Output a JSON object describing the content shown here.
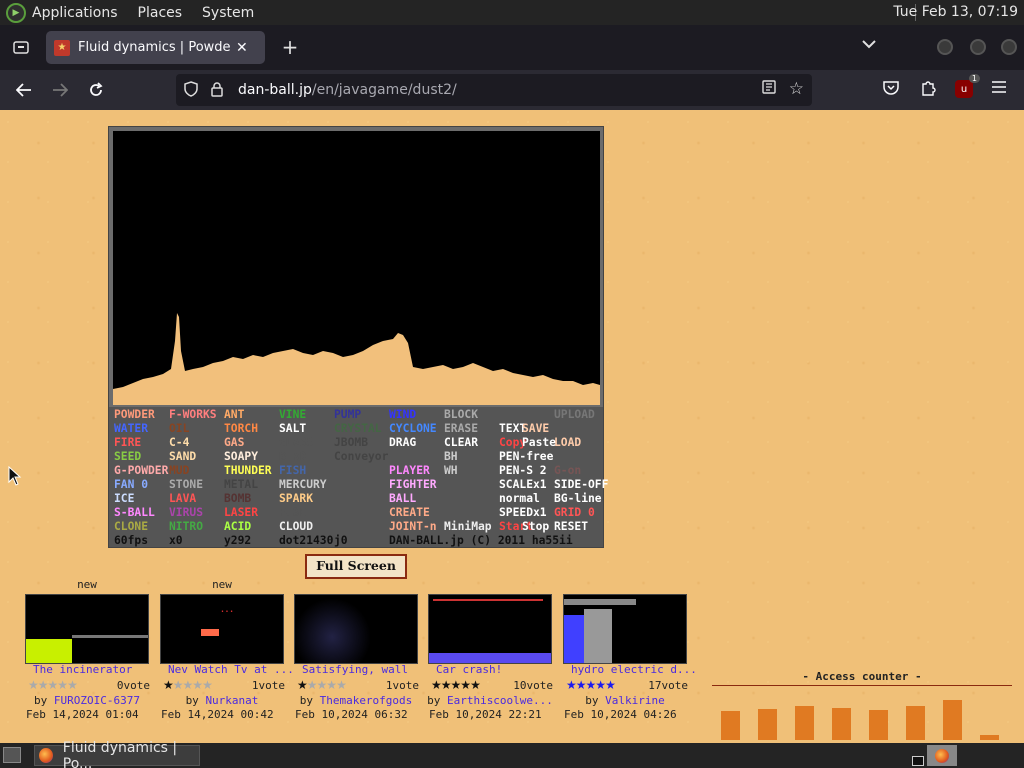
{
  "topbar": {
    "menus": [
      "Applications",
      "Places",
      "System"
    ],
    "clock": "Tue Feb 13, 07:19"
  },
  "tab": {
    "title": "Fluid dynamics | Powder Game",
    "close": "✕",
    "new": "+"
  },
  "url": {
    "domain": "dan-ball.jp",
    "path": "/en/javagame/dust2/"
  },
  "ublock_count": "1",
  "panel_rows": [
    [
      [
        "POWDER",
        "#ff9a7a"
      ],
      [
        "F-WORKS",
        "#ff7f7f"
      ],
      [
        "ANT",
        "#ffaa66"
      ],
      [
        "VINE",
        "#33aa33"
      ],
      [
        "PUMP",
        "#333399"
      ],
      [
        "WIND",
        "#3333ff"
      ],
      [
        "BLOCK",
        "#aaaaaa"
      ],
      [
        "",
        "#fff"
      ],
      [
        "",
        "#fff"
      ],
      [
        "UPLOAD",
        "#777777"
      ]
    ],
    [
      [
        "WATER",
        "#4466ff"
      ],
      [
        "OIL",
        "#884422"
      ],
      [
        "TORCH",
        "#ff8844"
      ],
      [
        "SALT",
        "#ffffff"
      ],
      [
        "CRYSTAL",
        "#446644"
      ],
      [
        "CYCLONE",
        "#4488ff"
      ],
      [
        "ERASE",
        "#aaaaaa"
      ],
      [
        "TEXT",
        "#ffffff"
      ],
      [
        "SAVE",
        "#ffccaa"
      ],
      [
        "",
        ""
      ]
    ],
    [
      [
        "FIRE",
        "#ff5555"
      ],
      [
        "C-4",
        "#ffddaa"
      ],
      [
        "GAS",
        "#ffaa88"
      ],
      [
        "GLASS",
        "#555555"
      ],
      [
        "JBOMB",
        "#444444"
      ],
      [
        "DRAG",
        "#ffffff"
      ],
      [
        "CLEAR",
        "#ffffff"
      ],
      [
        "Copy",
        "#ff4444"
      ],
      [
        "Paste",
        "#ffffff"
      ],
      [
        "LOAD",
        "#ffccaa"
      ]
    ],
    [
      [
        "SEED",
        "#88cc44"
      ],
      [
        "SAND",
        "#ffddaa"
      ],
      [
        "SOAPY",
        "#ffeedd"
      ],
      [
        "BIRD",
        "#555555"
      ],
      [
        "Conveyor",
        "#444444"
      ],
      [
        "",
        ""
      ],
      [
        "BH",
        "#cccccc"
      ],
      [
        "PEN-free",
        "#ffffff"
      ],
      [
        "",
        ""
      ],
      [
        "",
        ""
      ]
    ],
    [
      [
        "G-POWDER",
        "#ffaaaa"
      ],
      [
        "MUD",
        "#884422"
      ],
      [
        "THUNDER",
        "#ffff55"
      ],
      [
        "FISH",
        "#4466aa"
      ],
      [
        "",
        ""
      ],
      [
        "PLAYER",
        "#ff88ff"
      ],
      [
        "WH",
        "#cccccc"
      ],
      [
        "PEN-S 2",
        "#ffffff"
      ],
      [
        "G-on",
        "#775555"
      ],
      [
        "",
        ""
      ]
    ],
    [
      [
        "FAN 0",
        "#88aaff"
      ],
      [
        "STONE",
        "#aaaaaa"
      ],
      [
        "METAL",
        "#444444"
      ],
      [
        "MERCURY",
        "#cccccc"
      ],
      [
        "",
        ""
      ],
      [
        "FIGHTER",
        "#ffaaff"
      ],
      [
        "",
        ""
      ],
      [
        "SCALEx1",
        "#ffffff"
      ],
      [
        "SIDE-OFF",
        "#ffffff"
      ],
      [
        "",
        ""
      ]
    ],
    [
      [
        "ICE",
        "#ccddff"
      ],
      [
        "LAVA",
        "#ff5555"
      ],
      [
        "BOMB",
        "#553333"
      ],
      [
        "SPARK",
        "#ffcc88"
      ],
      [
        "",
        ""
      ],
      [
        "BALL",
        "#ffaaff"
      ],
      [
        "",
        ""
      ],
      [
        "normal",
        "#ffffff"
      ],
      [
        "BG-line",
        "#ffffff"
      ],
      [
        "",
        ""
      ]
    ],
    [
      [
        "S-BALL",
        "#ff88ff"
      ],
      [
        "VIRUS",
        "#aa44aa"
      ],
      [
        "LASER",
        "#ff4444"
      ],
      [
        "FUSE",
        "#555555"
      ],
      [
        "",
        ""
      ],
      [
        "CREATE",
        "#ffaa88"
      ],
      [
        "",
        ""
      ],
      [
        "SPEEDx1",
        "#ffffff"
      ],
      [
        "GRID 0",
        "#ff5555"
      ],
      [
        "",
        ""
      ]
    ],
    [
      [
        "CLONE",
        "#aaaa44"
      ],
      [
        "NITRO",
        "#44aa44"
      ],
      [
        "ACID",
        "#aaff44"
      ],
      [
        "CLOUD",
        "#eeeeee"
      ],
      [
        "",
        ""
      ],
      [
        "JOINT-n",
        "#ffaa88"
      ],
      [
        "MiniMap",
        "#eeeeee"
      ],
      [
        "Start",
        "#ff4444"
      ],
      [
        "Stop",
        "#ffffff"
      ],
      [
        "RESET",
        "#ffffff"
      ]
    ],
    [
      [
        "60fps",
        "#111111"
      ],
      [
        "x0",
        "#111111"
      ],
      [
        "y292",
        "#111111"
      ],
      [
        "dot21430",
        "#111111"
      ],
      [
        "j0",
        "#111111"
      ],
      [
        "DAN-BALL.jp (C) 2011 ha55ii",
        "#111111"
      ],
      [
        "",
        ""
      ],
      [
        "",
        ""
      ],
      [
        "",
        ""
      ],
      [
        "",
        ""
      ]
    ]
  ],
  "fullscreen": "Full Screen",
  "thumbnails": [
    {
      "new": "new",
      "title": "The incinerator",
      "votes": "0vote",
      "stars": 0,
      "by": "by",
      "author": "FUROZOIC-6377",
      "date": "Feb 14,2024 01:04"
    },
    {
      "new": "new",
      "title": "Nev Watch Tv at ...",
      "votes": "1vote",
      "stars": 1,
      "by": "by",
      "author": "Nurkanat",
      "date": "Feb 14,2024 00:42"
    },
    {
      "new": "",
      "title": "Satisfying, wall",
      "votes": "1vote",
      "stars": 1,
      "by": "by",
      "author": "Themakerofgods",
      "date": "Feb 10,2024 06:32"
    },
    {
      "new": "",
      "title": "Car crash!",
      "votes": "10vote",
      "stars": 5,
      "by": "by",
      "author": "Earthiscoolwe...",
      "date": "Feb 10,2024 22:21"
    },
    {
      "new": "",
      "title": "hydro electric d...",
      "votes": "17vote",
      "stars": 5,
      "by": "by",
      "author": "Valkirine",
      "date": "Feb 10,2024 04:26"
    }
  ],
  "counter": {
    "title": "- Access counter -",
    "values": [
      0.48,
      0.52,
      0.56,
      0.54,
      0.5,
      0.56,
      0.66,
      0.08
    ]
  },
  "taskbar": {
    "task": "Fluid dynamics | Po..."
  }
}
